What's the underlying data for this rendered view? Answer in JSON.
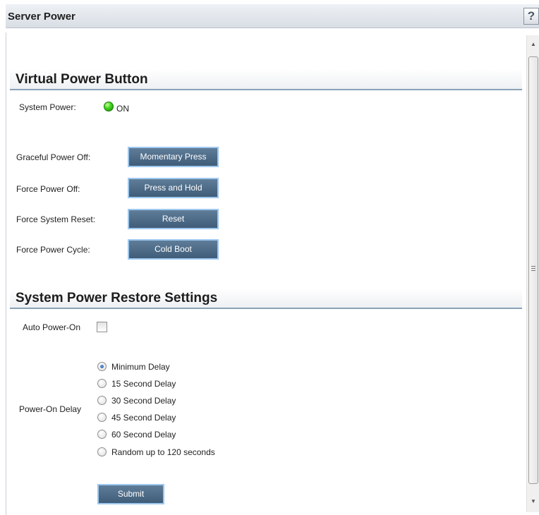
{
  "window": {
    "title": "Server Power",
    "help_label": "?"
  },
  "virtual_power": {
    "heading": "Virtual Power Button",
    "system_power_label": "System Power:",
    "system_power_state": "ON",
    "indicator_color": "#3ed21b",
    "actions": [
      {
        "label": "Graceful Power Off:",
        "button": "Momentary Press"
      },
      {
        "label": "Force Power Off:",
        "button": "Press and Hold"
      },
      {
        "label": "Force System Reset:",
        "button": "Reset"
      },
      {
        "label": "Force Power Cycle:",
        "button": "Cold Boot"
      }
    ]
  },
  "restore_settings": {
    "heading": "System Power Restore Settings",
    "auto_power_on_label": "Auto Power-On",
    "auto_power_on_checked": false,
    "power_on_delay_label": "Power-On Delay",
    "delay_options": [
      {
        "label": "Minimum Delay",
        "selected": true
      },
      {
        "label": "15 Second Delay",
        "selected": false
      },
      {
        "label": "30 Second Delay",
        "selected": false
      },
      {
        "label": "45 Second Delay",
        "selected": false
      },
      {
        "label": "60 Second Delay",
        "selected": false
      },
      {
        "label": "Random up to 120 seconds",
        "selected": false
      }
    ],
    "submit_label": "Submit"
  },
  "colors": {
    "button_bg": "#4e6c89",
    "button_border": "#9ec8ee",
    "header_rule": "#8aa1b8"
  },
  "icons": [
    "help-icon",
    "power-led-icon",
    "scroll-up-arrow-icon",
    "scroll-down-arrow-icon",
    "scroll-grip-icon"
  ]
}
